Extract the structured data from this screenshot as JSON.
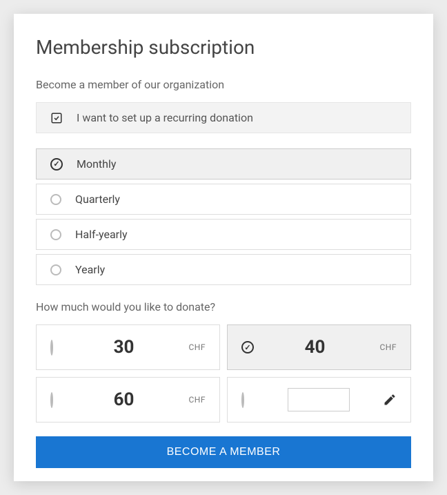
{
  "title": "Membership subscription",
  "subtitle": "Become a member of our organization",
  "recurring": {
    "label": "I want to set up a recurring donation",
    "checked": true
  },
  "frequency": {
    "options": [
      {
        "label": "Monthly",
        "selected": true
      },
      {
        "label": "Quarterly",
        "selected": false
      },
      {
        "label": "Half-yearly",
        "selected": false
      },
      {
        "label": "Yearly",
        "selected": false
      }
    ]
  },
  "amount_question": "How much would you like to donate?",
  "amounts": [
    {
      "value": "30",
      "currency": "CHF",
      "selected": false
    },
    {
      "value": "40",
      "currency": "CHF",
      "selected": true
    },
    {
      "value": "60",
      "currency": "CHF",
      "selected": false
    }
  ],
  "custom_amount": {
    "value": ""
  },
  "submit_label": "BECOME A MEMBER"
}
